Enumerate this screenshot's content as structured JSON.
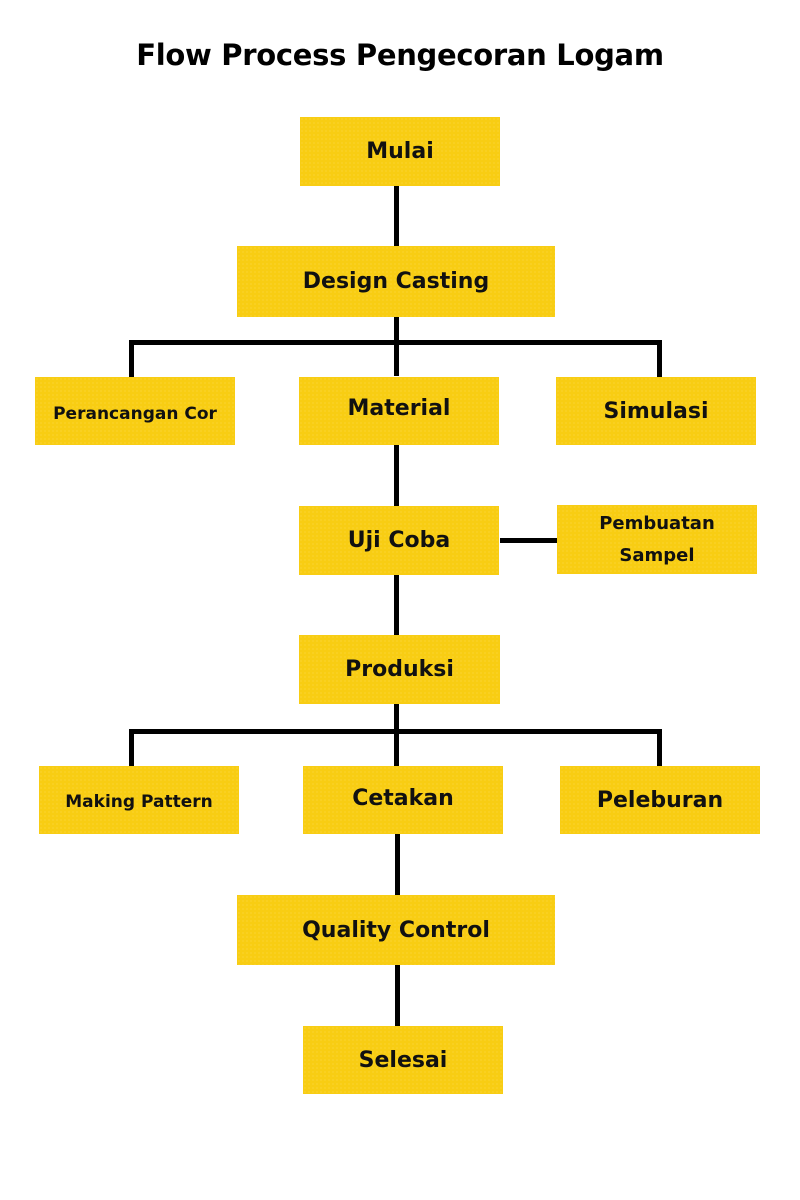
{
  "title": "Flow Process Pengecoran Logam",
  "colors": {
    "box_fill": "#F8CD13",
    "connector": "#000000",
    "text": "#111111"
  },
  "nodes": {
    "start": "Mulai",
    "design_casting": "Design Casting",
    "perancangan_cor": "Perancangan Cor",
    "material": "Material",
    "simulasi": "Simulasi",
    "uji_coba": "Uji Coba",
    "pembuatan_sampel_line1": "Pembuatan",
    "pembuatan_sampel_line2": "Sampel",
    "produksi": "Produksi",
    "making_pattern": "Making Pattern",
    "cetakan": "Cetakan",
    "peleburan": "Peleburan",
    "quality_control": "Quality Control",
    "end": "Selesai"
  },
  "edges": [
    [
      "Mulai",
      "Design Casting"
    ],
    [
      "Design Casting",
      "Perancangan Cor"
    ],
    [
      "Design Casting",
      "Material"
    ],
    [
      "Design Casting",
      "Simulasi"
    ],
    [
      "Material",
      "Uji Coba"
    ],
    [
      "Uji Coba",
      "Pembuatan Sampel"
    ],
    [
      "Uji Coba",
      "Produksi"
    ],
    [
      "Produksi",
      "Making Pattern"
    ],
    [
      "Produksi",
      "Cetakan"
    ],
    [
      "Produksi",
      "Peleburan"
    ],
    [
      "Cetakan",
      "Quality Control"
    ],
    [
      "Quality Control",
      "Selesai"
    ]
  ]
}
